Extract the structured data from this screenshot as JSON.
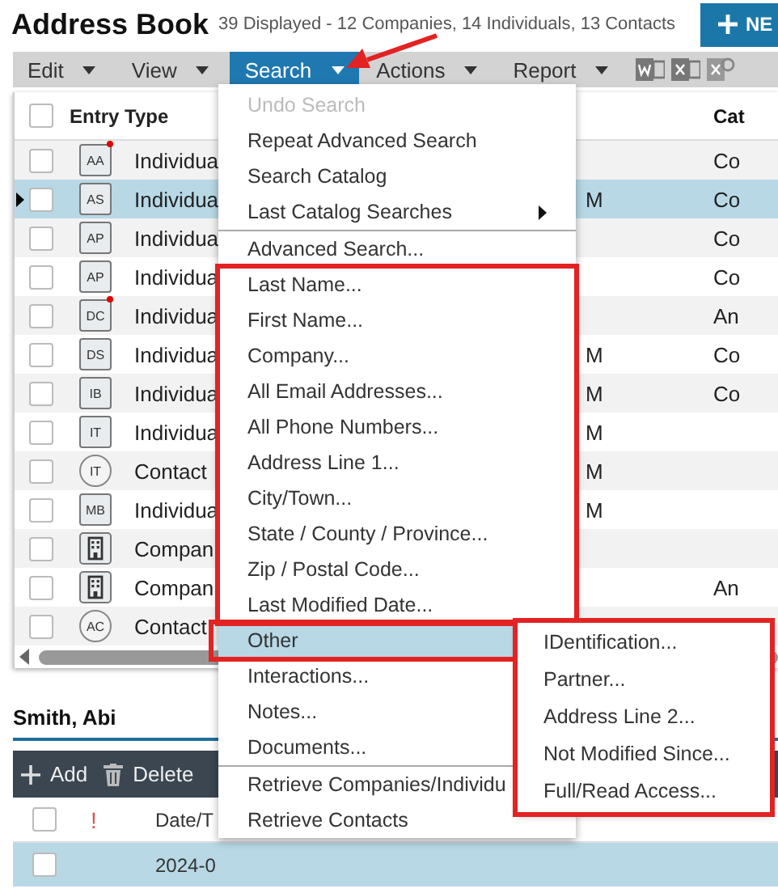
{
  "header": {
    "title": "Address Book",
    "summary": "39 Displayed - 12 Companies, 14 Individuals, 13 Contacts",
    "new_button": "NE"
  },
  "menubar": [
    {
      "label": "Edit",
      "selected": false
    },
    {
      "label": "View",
      "selected": false
    },
    {
      "label": "Search",
      "selected": true
    },
    {
      "label": "Actions",
      "selected": false
    },
    {
      "label": "Report",
      "selected": false
    }
  ],
  "table": {
    "header_checked": false,
    "columns": [
      "Entry Type",
      "Cat"
    ],
    "rows": [
      {
        "initials": "AA",
        "kind": "individual",
        "flagged": true,
        "entry_type": "Individua",
        "column_3": "",
        "category": "Co",
        "checked": false,
        "selected": false
      },
      {
        "initials": "AS",
        "kind": "individual",
        "flagged": false,
        "entry_type": "Individua",
        "column_3": "M",
        "category": "Co",
        "checked": false,
        "selected": true
      },
      {
        "initials": "AP",
        "kind": "individual",
        "flagged": false,
        "entry_type": "Individua",
        "column_3": "",
        "category": "Co",
        "checked": false,
        "selected": false
      },
      {
        "initials": "AP",
        "kind": "individual",
        "flagged": false,
        "entry_type": "Individua",
        "column_3": "",
        "category": "Co",
        "checked": false,
        "selected": false
      },
      {
        "initials": "DC",
        "kind": "individual",
        "flagged": true,
        "entry_type": "Individua",
        "column_3": "",
        "category": "An",
        "checked": false,
        "selected": false
      },
      {
        "initials": "DS",
        "kind": "individual",
        "flagged": false,
        "entry_type": "Individua",
        "column_3": "M",
        "category": "Co",
        "checked": false,
        "selected": false
      },
      {
        "initials": "IB",
        "kind": "individual",
        "flagged": false,
        "entry_type": "Individua",
        "column_3": "M",
        "category": "Co",
        "checked": false,
        "selected": false
      },
      {
        "initials": "IT",
        "kind": "individual",
        "flagged": false,
        "entry_type": "Individua",
        "column_3": "M",
        "category": "",
        "checked": false,
        "selected": false
      },
      {
        "initials": "IT",
        "kind": "contact",
        "flagged": false,
        "entry_type": "Contact",
        "column_3": "M",
        "category": "",
        "checked": false,
        "selected": false
      },
      {
        "initials": "MB",
        "kind": "individual",
        "flagged": false,
        "entry_type": "Individua",
        "column_3": "M",
        "category": "",
        "checked": false,
        "selected": false
      },
      {
        "initials": "",
        "kind": "company",
        "flagged": false,
        "entry_type": "Compan",
        "column_3": "",
        "category": "",
        "checked": false,
        "selected": false
      },
      {
        "initials": "",
        "kind": "company",
        "flagged": false,
        "entry_type": "Compan",
        "column_3": "",
        "category": "An",
        "checked": false,
        "selected": false
      },
      {
        "initials": "AC",
        "kind": "contact",
        "flagged": false,
        "entry_type": "Contact",
        "column_3": "",
        "category": "",
        "checked": false,
        "selected": false
      }
    ]
  },
  "detail": {
    "name": "Smith, Abi",
    "toolbar": [
      {
        "kind": "add",
        "label": "Add"
      },
      {
        "kind": "delete",
        "label": "Delete"
      }
    ],
    "columns": [
      "!",
      "Date/T"
    ],
    "header_checked": false,
    "rows": [
      {
        "checked": false,
        "selected": true,
        "column_2": "2024-0"
      }
    ]
  },
  "search_menu": {
    "items": [
      {
        "label": "Undo Search",
        "disabled": true,
        "selected": false,
        "submenu": false,
        "separator_before": false,
        "annotated": false
      },
      {
        "label": "Repeat Advanced Search",
        "disabled": false,
        "selected": false,
        "submenu": false,
        "separator_before": false,
        "annotated": false
      },
      {
        "label": "Search Catalog",
        "disabled": false,
        "selected": false,
        "submenu": false,
        "separator_before": false,
        "annotated": false
      },
      {
        "label": "Last Catalog Searches",
        "disabled": false,
        "selected": false,
        "submenu": true,
        "separator_before": false,
        "annotated": false
      },
      {
        "label": "Advanced Search...",
        "disabled": false,
        "selected": false,
        "submenu": false,
        "separator_before": true,
        "annotated": false
      },
      {
        "label": "Last Name...",
        "disabled": false,
        "selected": false,
        "submenu": false,
        "separator_before": false,
        "annotated": true
      },
      {
        "label": "First Name...",
        "disabled": false,
        "selected": false,
        "submenu": false,
        "separator_before": false,
        "annotated": true
      },
      {
        "label": "Company...",
        "disabled": false,
        "selected": false,
        "submenu": false,
        "separator_before": false,
        "annotated": true
      },
      {
        "label": "All Email Addresses...",
        "disabled": false,
        "selected": false,
        "submenu": false,
        "separator_before": false,
        "annotated": true
      },
      {
        "label": "All Phone Numbers...",
        "disabled": false,
        "selected": false,
        "submenu": false,
        "separator_before": false,
        "annotated": true
      },
      {
        "label": "Address Line 1...",
        "disabled": false,
        "selected": false,
        "submenu": false,
        "separator_before": false,
        "annotated": true
      },
      {
        "label": "City/Town...",
        "disabled": false,
        "selected": false,
        "submenu": false,
        "separator_before": false,
        "annotated": true
      },
      {
        "label": "State / County / Province...",
        "disabled": false,
        "selected": false,
        "submenu": false,
        "separator_before": false,
        "annotated": true
      },
      {
        "label": "Zip / Postal Code...",
        "disabled": false,
        "selected": false,
        "submenu": false,
        "separator_before": false,
        "annotated": true
      },
      {
        "label": "Last Modified Date...",
        "disabled": false,
        "selected": false,
        "submenu": false,
        "separator_before": false,
        "annotated": true
      },
      {
        "label": "Other",
        "disabled": false,
        "selected": true,
        "submenu": false,
        "separator_before": false,
        "annotated": true
      },
      {
        "label": "Interactions...",
        "disabled": false,
        "selected": false,
        "submenu": false,
        "separator_before": false,
        "annotated": false
      },
      {
        "label": "Notes...",
        "disabled": false,
        "selected": false,
        "submenu": false,
        "separator_before": false,
        "annotated": false
      },
      {
        "label": "Documents...",
        "disabled": false,
        "selected": false,
        "submenu": false,
        "separator_before": false,
        "annotated": false
      },
      {
        "label": "Retrieve Companies/Individu",
        "disabled": false,
        "selected": false,
        "submenu": false,
        "separator_before": true,
        "annotated": false
      },
      {
        "label": "Retrieve Contacts",
        "disabled": false,
        "selected": false,
        "submenu": false,
        "separator_before": false,
        "annotated": false
      }
    ],
    "other_submenu": {
      "annotated": true,
      "items": [
        "IDentification...",
        "Partner...",
        "Address Line 2...",
        "Not Modified Since...",
        "Full/Read Access..."
      ]
    }
  },
  "annotation_arrow": true
}
